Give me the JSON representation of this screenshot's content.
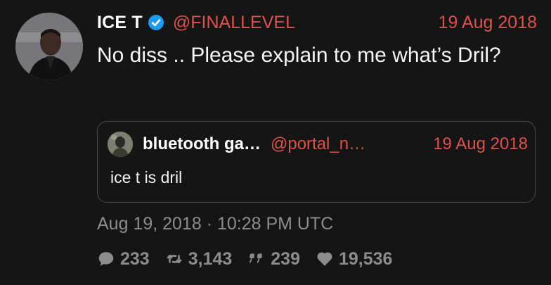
{
  "tweet": {
    "author_name": "ICE T",
    "author_handle": "@FINALLEVEL",
    "date": "19 Aug 2018",
    "text": "No diss .. Please explain to me what’s Dril?",
    "timestamp": "Aug 19, 2018 · 10:28 PM UTC",
    "verified_icon": "verified-badge-icon"
  },
  "quoted_tweet": {
    "author_name": "bluetooth ga…",
    "author_handle": "@portal_n…",
    "date": "19 Aug 2018",
    "text": "ice t is dril"
  },
  "stats": {
    "replies": "233",
    "retweets": "3,143",
    "quotes": "239",
    "likes": "19,536"
  },
  "colors": {
    "background": "#151515",
    "accent": "#e0504a",
    "muted": "#8c8c8c",
    "verified": "#1d9bf0"
  }
}
